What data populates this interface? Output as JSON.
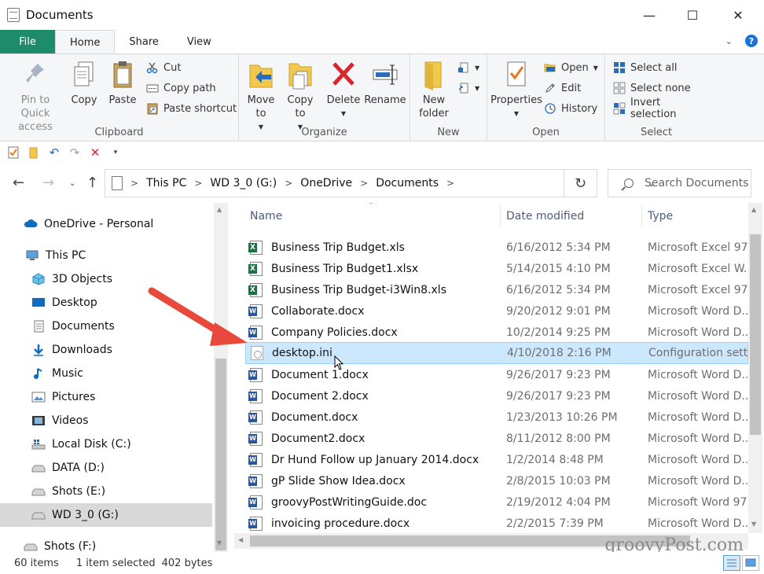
{
  "window": {
    "title": "Documents",
    "min_glyph": "—",
    "max_glyph": "☐",
    "close_glyph": "✕"
  },
  "tabs": {
    "file": "File",
    "items": [
      "Home",
      "Share",
      "View"
    ],
    "active": "Home",
    "help_glyph": "?"
  },
  "ribbon": {
    "clipboard": {
      "label": "Clipboard",
      "pin": "Pin to Quick access",
      "copy": "Copy",
      "paste": "Paste",
      "cut": "Cut",
      "copy_path": "Copy path",
      "paste_shortcut": "Paste shortcut"
    },
    "organize": {
      "label": "Organize",
      "move_to": "Move to",
      "copy_to": "Copy to",
      "delete": "Delete",
      "rename": "Rename"
    },
    "new": {
      "label": "New",
      "new_folder": "New folder"
    },
    "open": {
      "label": "Open",
      "properties": "Properties",
      "open": "Open",
      "edit": "Edit",
      "history": "History"
    },
    "select": {
      "label": "Select",
      "select_all": "Select all",
      "select_none": "Select none",
      "invert": "Invert selection"
    }
  },
  "address": {
    "crumbs": [
      "This PC",
      "WD 3_0 (G:)",
      "OneDrive",
      "Documents"
    ],
    "search_placeholder": "Search Documents"
  },
  "nav_pane": {
    "items": [
      {
        "label": "OneDrive - Personal",
        "icon": "cloud-icon"
      },
      {
        "label": "This PC",
        "icon": "computer-icon"
      },
      {
        "label": "3D Objects",
        "icon": "cube-icon"
      },
      {
        "label": "Desktop",
        "icon": "desktop-icon"
      },
      {
        "label": "Documents",
        "icon": "document-icon"
      },
      {
        "label": "Downloads",
        "icon": "download-icon"
      },
      {
        "label": "Music",
        "icon": "music-icon"
      },
      {
        "label": "Pictures",
        "icon": "pictures-icon"
      },
      {
        "label": "Videos",
        "icon": "video-icon"
      },
      {
        "label": "Local Disk (C:)",
        "icon": "drive-icon"
      },
      {
        "label": "DATA (D:)",
        "icon": "drive-icon"
      },
      {
        "label": "Shots (E:)",
        "icon": "drive-icon"
      },
      {
        "label": "WD 3_0 (G:)",
        "icon": "drive-icon"
      },
      {
        "label": "Shots (F:)",
        "icon": "drive-icon"
      }
    ],
    "selected": "WD 3_0 (G:)"
  },
  "file_list": {
    "columns": [
      "Name",
      "Date modified",
      "Type"
    ],
    "rows": [
      {
        "name": "Business Trip Budget.xls",
        "date": "6/16/2012 5:34 PM",
        "type": "Microsoft Excel 97...",
        "kind": "xls"
      },
      {
        "name": "Business Trip Budget1.xlsx",
        "date": "5/14/2015 4:10 PM",
        "type": "Microsoft Excel W...",
        "kind": "xls"
      },
      {
        "name": "Business Trip Budget-i3Win8.xls",
        "date": "6/16/2012 5:34 PM",
        "type": "Microsoft Excel 97...",
        "kind": "xls"
      },
      {
        "name": "Collaborate.docx",
        "date": "9/20/2012 9:01 PM",
        "type": "Microsoft Word D...",
        "kind": "doc"
      },
      {
        "name": "Company Policies.docx",
        "date": "10/2/2014 9:25 PM",
        "type": "Microsoft Word D...",
        "kind": "doc"
      },
      {
        "name": "desktop.ini",
        "date": "4/10/2018 2:16 PM",
        "type": "Configuration setti...",
        "kind": "ini"
      },
      {
        "name": "Document 1.docx",
        "date": "9/26/2017 9:23 PM",
        "type": "Microsoft Word D...",
        "kind": "doc"
      },
      {
        "name": "Document 2.docx",
        "date": "9/26/2017 9:23 PM",
        "type": "Microsoft Word D...",
        "kind": "doc"
      },
      {
        "name": "Document.docx",
        "date": "1/23/2013 10:26 PM",
        "type": "Microsoft Word D...",
        "kind": "doc"
      },
      {
        "name": "Document2.docx",
        "date": "8/11/2012 8:00 PM",
        "type": "Microsoft Word D...",
        "kind": "doc"
      },
      {
        "name": "Dr Hund Follow up January 2014.docx",
        "date": "1/2/2014 8:48 PM",
        "type": "Microsoft Word D...",
        "kind": "doc"
      },
      {
        "name": "gP Slide Show Idea.docx",
        "date": "2/8/2015 10:03 PM",
        "type": "Microsoft Word D...",
        "kind": "doc"
      },
      {
        "name": "groovyPostWritingGuide.doc",
        "date": "2/19/2012 4:04 PM",
        "type": "Microsoft Word 97...",
        "kind": "doc"
      },
      {
        "name": "invoicing procedure.docx",
        "date": "2/2/2015 7:39 PM",
        "type": "Microsoft Word D...",
        "kind": "doc"
      }
    ],
    "selected": "desktop.ini"
  },
  "status": {
    "count": "60 items",
    "selected": "1 item selected",
    "size": "402 bytes"
  },
  "watermark": "groovyPost.com",
  "colors": {
    "file_tab": "#1e8b6b",
    "selection": "#cce8ff",
    "annotation_arrow": "#e8493a"
  }
}
